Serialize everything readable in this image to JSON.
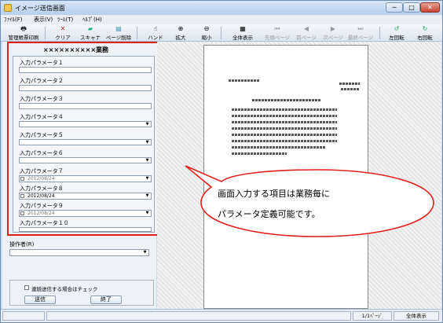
{
  "window": {
    "title": "イメージ送信画面",
    "min_glyph": "─",
    "max_glyph": "□",
    "close_glyph": "✕"
  },
  "menu": [
    "ﾌｧｲﾙ(F)",
    "表示(V)",
    "ﾂｰﾙ(T)",
    "ﾍﾙﾌﾟ(H)"
  ],
  "toolbar": {
    "print": "管理帳票印刷",
    "clear": "クリア",
    "scanner": "スキャナ",
    "delete_page": "ページ削除",
    "hand": "ハンド",
    "zoom_in": "拡大",
    "zoom_out": "縮小",
    "fit": "全体表示",
    "first": "先頭ページ",
    "prev": "前ページ",
    "next": "次ページ",
    "last": "最終ページ",
    "rotate_left": "左回転",
    "rotate_right": "右回転"
  },
  "icons": {
    "print": "printer-icon",
    "clear": "clear-icon",
    "scanner": "scanner-icon",
    "delete_page": "delete-page-icon",
    "hand": "hand-icon",
    "zoom_in": "zoom-in-icon",
    "zoom_out": "zoom-out-icon",
    "fit": "fit-icon",
    "first": "first-page-icon",
    "prev": "prev-page-icon",
    "next": "next-page-icon",
    "last": "last-page-icon",
    "rotate_left": "rotate-left-icon",
    "rotate_right": "rotate-right-icon"
  },
  "panel": {
    "title": "××××××××××業務",
    "params": [
      {
        "label": "入力パラメータ１",
        "type": "text",
        "value": ""
      },
      {
        "label": "入力パラメータ２",
        "type": "text",
        "value": ""
      },
      {
        "label": "入力パラメータ３",
        "type": "text",
        "value": ""
      },
      {
        "label": "入力パラメータ４",
        "type": "select",
        "value": ""
      },
      {
        "label": "入力パラメータ５",
        "type": "select",
        "value": ""
      },
      {
        "label": "入力パラメータ６",
        "type": "select",
        "value": ""
      },
      {
        "label": "入力パラメータ７",
        "type": "date",
        "value": "2012/08/24",
        "checked": false
      },
      {
        "label": "入力パラメータ８",
        "type": "date",
        "value": "2012/08/24",
        "checked": true
      },
      {
        "label": "入力パラメータ９",
        "type": "date",
        "value": "2012/08/24",
        "checked": false
      },
      {
        "label": "入力パラメータ１０",
        "type": "text",
        "value": ""
      }
    ],
    "operator_label": "操作者(R)",
    "operator_value": "",
    "continuous_label": "連続送信する場合はチェック",
    "continuous_checked": false,
    "send_button": "送信",
    "end_button": "終了"
  },
  "dropdown_glyph": "▼",
  "callout": {
    "line1": "画面入力する項目は業務毎に",
    "line2": "パラメータ定義可能です。",
    "border_color": "#e0211b"
  },
  "status": {
    "page": "1/1ﾍﾟｰｼﾞ",
    "zoom": "全体表示"
  },
  "colors": {
    "highlight": "#e0211b",
    "window_bg": "#c9dbef"
  }
}
